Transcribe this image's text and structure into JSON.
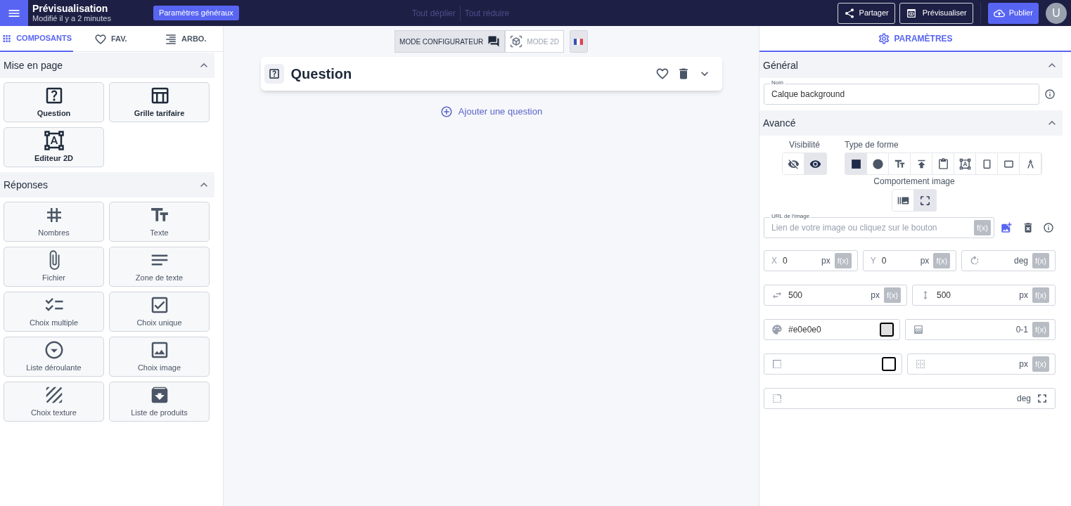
{
  "header": {
    "title": "Prévisualisation",
    "subtitle": "Modifié il y a 2 minutes",
    "settings_button": "Paramètres généraux",
    "expand_all": "Tout déplier",
    "collapse_all": "Tout réduire",
    "share": "Partager",
    "preview": "Prévisualiser",
    "publish": "Publier",
    "avatar": "U"
  },
  "left_tabs": [
    {
      "kind": "grid",
      "label": "COMPOSANTS",
      "selected": true
    },
    {
      "kind": "heart",
      "label": "FAV.",
      "selected": false
    },
    {
      "kind": "tree",
      "label": "ARBO.",
      "selected": false
    }
  ],
  "sections": [
    {
      "title": "Mise en page",
      "expanded": true,
      "components": [
        {
          "kind": "question",
          "label": "Question"
        },
        {
          "kind": "pricing",
          "label": "Grille tarifaire"
        },
        {
          "kind": "editor",
          "label": "Editeur 2D"
        }
      ]
    },
    {
      "title": "Réponses",
      "expanded": true,
      "components": [
        {
          "kind": "number",
          "label": "Nombres"
        },
        {
          "kind": "text",
          "label": "Texte"
        },
        {
          "kind": "file",
          "label": "Fichier"
        },
        {
          "kind": "textarea",
          "label": "Zone de texte"
        },
        {
          "kind": "multi",
          "label": "Choix multiple"
        },
        {
          "kind": "single",
          "label": "Choix unique"
        },
        {
          "kind": "dropdown",
          "label": "Liste déroulante"
        },
        {
          "kind": "image",
          "label": "Choix image"
        },
        {
          "kind": "texture",
          "label": "Choix texture"
        },
        {
          "kind": "products",
          "label": "Liste de produits"
        }
      ]
    }
  ],
  "canvas": {
    "modes": [
      {
        "kind": "configurator",
        "label": "MODE CONFIGURATEUR",
        "selected": true
      },
      {
        "kind": "view2d",
        "label": "MODE 2D",
        "selected": false
      }
    ],
    "question_card": {
      "title": "Question"
    },
    "add_question": "Ajouter une question"
  },
  "settings": {
    "tab": "PARAMÈTRES",
    "general": {
      "title": "Général",
      "expanded": true,
      "name_field": {
        "label": "Nom",
        "value": "Calque background"
      }
    },
    "advanced": {
      "title": "Avancé",
      "expanded": true,
      "visibility": {
        "label": "Visibilité",
        "options": [
          {
            "kind": "hidden",
            "selected": false
          },
          {
            "kind": "visible",
            "selected": true
          }
        ]
      },
      "shape_type": {
        "label": "Type de forme",
        "options": [
          {
            "kind": "square",
            "selected": true
          },
          {
            "kind": "circle",
            "selected": false
          },
          {
            "kind": "text",
            "selected": false
          },
          {
            "kind": "upload",
            "selected": false
          },
          {
            "kind": "clipboard",
            "selected": false
          },
          {
            "kind": "shapes",
            "selected": false
          },
          {
            "kind": "portrait",
            "selected": false
          },
          {
            "kind": "landscape",
            "selected": false
          },
          {
            "kind": "compass",
            "selected": false
          }
        ]
      },
      "image_behaviour": {
        "label": "Comportement image",
        "options": [
          {
            "kind": "tile",
            "selected": false
          },
          {
            "kind": "fit",
            "selected": true
          }
        ]
      },
      "url_field": {
        "label": "URL de l'image",
        "placeholder": "Lien de votre image ou cliquez sur le bouton",
        "formula": "f(x)"
      },
      "field_rows": [
        [
          {
            "kind": "x",
            "prefix": "X",
            "value": "0",
            "unit": "px",
            "formula": "f(x)"
          },
          {
            "kind": "y",
            "prefix": "Y",
            "value": "0",
            "unit": "px",
            "formula": "f(x)"
          },
          {
            "kind": "rotation",
            "unit": "deg",
            "formula": "f(x)"
          }
        ],
        [
          {
            "kind": "width",
            "value": "500",
            "unit": "px",
            "formula": "f(x)"
          },
          {
            "kind": "height",
            "value": "500",
            "unit": "px",
            "formula": "f(x)"
          }
        ],
        [
          {
            "kind": "color",
            "value": "#e0e0e0",
            "color": "#e0e0e0"
          },
          {
            "kind": "opacity",
            "unit": "0-1",
            "formula": "f(x)"
          }
        ],
        [
          {
            "kind": "border",
            "color": "#ffffff"
          },
          {
            "kind": "border_width",
            "unit": "px",
            "formula": "f(x)"
          }
        ],
        [
          {
            "kind": "radius",
            "unit": "deg",
            "fullscreen": true
          }
        ]
      ]
    }
  }
}
